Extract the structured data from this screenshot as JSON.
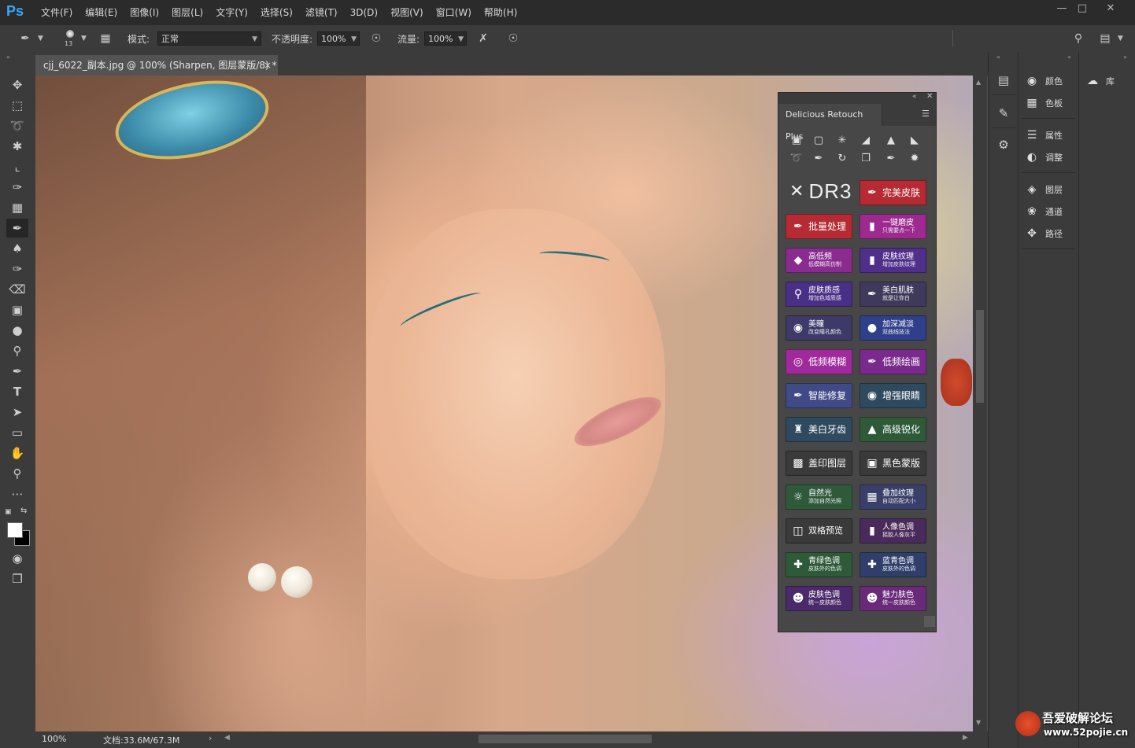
{
  "app": {
    "logo": "Ps",
    "menu": [
      "文件(F)",
      "编辑(E)",
      "图像(I)",
      "图层(L)",
      "文字(Y)",
      "选择(S)",
      "滤镜(T)",
      "3D(D)",
      "视图(V)",
      "窗口(W)",
      "帮助(H)"
    ]
  },
  "options_bar": {
    "brush_size": "13",
    "mode_label": "模式:",
    "mode_value": "正常",
    "opacity_label": "不透明度:",
    "opacity_value": "100%",
    "flow_label": "流量:",
    "flow_value": "100%"
  },
  "document": {
    "tab_title": "cjj_6022_副本.jpg @ 100% (Sharpen, 图层蒙版/8) *",
    "close_glyph": "×"
  },
  "status": {
    "zoom": "100%",
    "doc_size": "文档:33.6M/67.3M",
    "arrow": "›"
  },
  "plugin": {
    "tab": "Delicious Retouch Plus",
    "logo_text": "DR3",
    "buttons": [
      {
        "title": "完美皮肤",
        "color": "#b52a33",
        "icon": "brush-icon"
      },
      {
        "title": "批量处理",
        "color": "#b52a33",
        "icon": "brush-icon"
      },
      {
        "title": "一键磨皮",
        "sub": "只需要点一下",
        "color": "#9c2a8f",
        "icon": "bottle-icon"
      },
      {
        "title": "高低频",
        "sub": "低模糊高仿制",
        "color": "#8a2c8f",
        "icon": "diamond-icon"
      },
      {
        "title": "皮肤纹理",
        "sub": "增加皮肤纹理",
        "color": "#4f2f8a",
        "icon": "bottle-icon"
      },
      {
        "title": "皮肤质感",
        "sub": "增加色域质感",
        "color": "#4a2f86",
        "icon": "pin-icon"
      },
      {
        "title": "美白肌肤",
        "sub": "就是让你白",
        "color": "#3f3a5c",
        "icon": "brush-icon"
      },
      {
        "title": "美瞳",
        "sub": "改变瞳孔颜色",
        "color": "#3d3a6a",
        "icon": "eye-icon"
      },
      {
        "title": "加深减淡",
        "sub": "双曲线技法",
        "color": "#2f3f8a",
        "icon": "circle-icon"
      },
      {
        "title": "低频模糊",
        "color": "#a02a9c",
        "icon": "target-icon"
      },
      {
        "title": "低频绘画",
        "color": "#7a2a8c",
        "icon": "brush-icon"
      },
      {
        "title": "智能修复",
        "color": "#3f4a86",
        "icon": "bandage-icon"
      },
      {
        "title": "增强眼睛",
        "color": "#2f4a5f",
        "icon": "eye-icon"
      },
      {
        "title": "美白牙齿",
        "color": "#2f4a5f",
        "icon": "tooth-icon"
      },
      {
        "title": "高级锐化",
        "color": "#2f5a3a",
        "icon": "triangle-icon"
      },
      {
        "title": "盖印图层",
        "color": "#3a3a3a",
        "icon": "stamp-icon"
      },
      {
        "title": "黑色蒙版",
        "color": "#3a3a3a",
        "icon": "mask-icon"
      },
      {
        "title": "自然光",
        "sub": "添加自然光照",
        "color": "#2f5a3a",
        "icon": "sun-icon"
      },
      {
        "title": "叠加纹理",
        "sub": "自动匹配大小",
        "color": "#3a3f6a",
        "icon": "texture-icon"
      },
      {
        "title": "双格预览",
        "color": "#3a3a3a",
        "icon": "split-icon"
      },
      {
        "title": "人像色调",
        "sub": "摇胶人像灰平",
        "color": "#4a2a5a",
        "icon": "bottle-icon"
      },
      {
        "title": "青绿色调",
        "sub": "皮肤外的色调",
        "color": "#2f5a3a",
        "icon": "crosshair-icon"
      },
      {
        "title": "蓝青色调",
        "sub": "皮肤外的色调",
        "color": "#2f3f6a",
        "icon": "crosshair-icon"
      },
      {
        "title": "皮肤色调",
        "sub": "统一皮肤颜色",
        "color": "#4a2a6a",
        "icon": "face-icon"
      },
      {
        "title": "魅力肤色",
        "sub": "统一皮肤颜色",
        "color": "#6a2a7a",
        "icon": "face-icon"
      }
    ]
  },
  "right_panels": {
    "group1": [
      {
        "label": "颜色",
        "icon": "palette-icon"
      },
      {
        "label": "色板",
        "icon": "grid-icon"
      }
    ],
    "group2": [
      {
        "label": "属性",
        "icon": "sliders-icon"
      },
      {
        "label": "调整",
        "icon": "adjust-icon"
      }
    ],
    "group3": [
      {
        "label": "图层",
        "icon": "layers-icon"
      },
      {
        "label": "通道",
        "icon": "channels-icon"
      },
      {
        "label": "路径",
        "icon": "path-icon"
      }
    ],
    "library": {
      "label": "库",
      "icon": "cloud-icon"
    }
  },
  "watermark": {
    "line1": "吾爱破解论坛",
    "line2": "www.52pojie.cn"
  }
}
